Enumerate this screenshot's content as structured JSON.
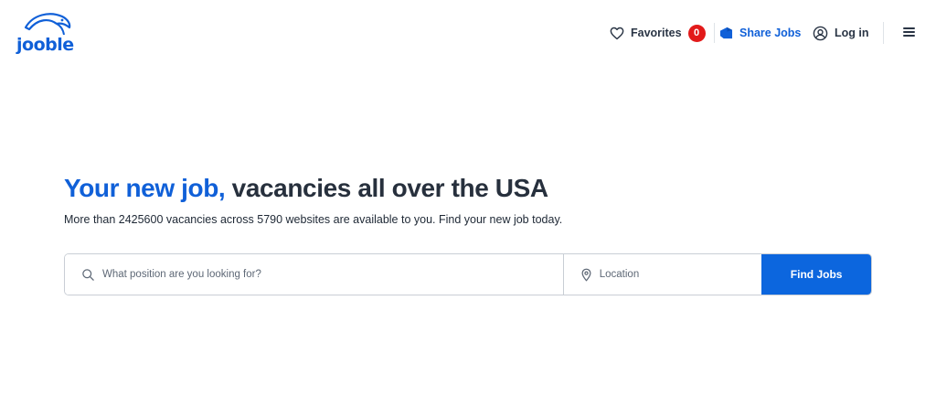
{
  "brand": {
    "logo_text": "jooble",
    "accent_color": "#1060d8",
    "badge_color": "#e21a1a"
  },
  "nav": {
    "favorites_label": "Favorites",
    "favorites_count": "0",
    "share_jobs_label": "Share Jobs",
    "login_label": "Log in"
  },
  "hero": {
    "title_accent": "Your new job,",
    "title_rest": " vacancies all over the USA",
    "subtitle": "More than 2425600 vacancies across 5790 websites are available to you. Find your new job today."
  },
  "search": {
    "position_placeholder": "What position are you looking for?",
    "position_value": "",
    "location_placeholder": "Location",
    "location_value": "",
    "button_label": "Find Jobs",
    "button_color": "#0c66de"
  },
  "icons": [
    "jooble-logo",
    "heart-icon",
    "share-icon",
    "user-circle-icon",
    "hamburger-menu-icon",
    "search-icon",
    "location-pin-icon"
  ]
}
